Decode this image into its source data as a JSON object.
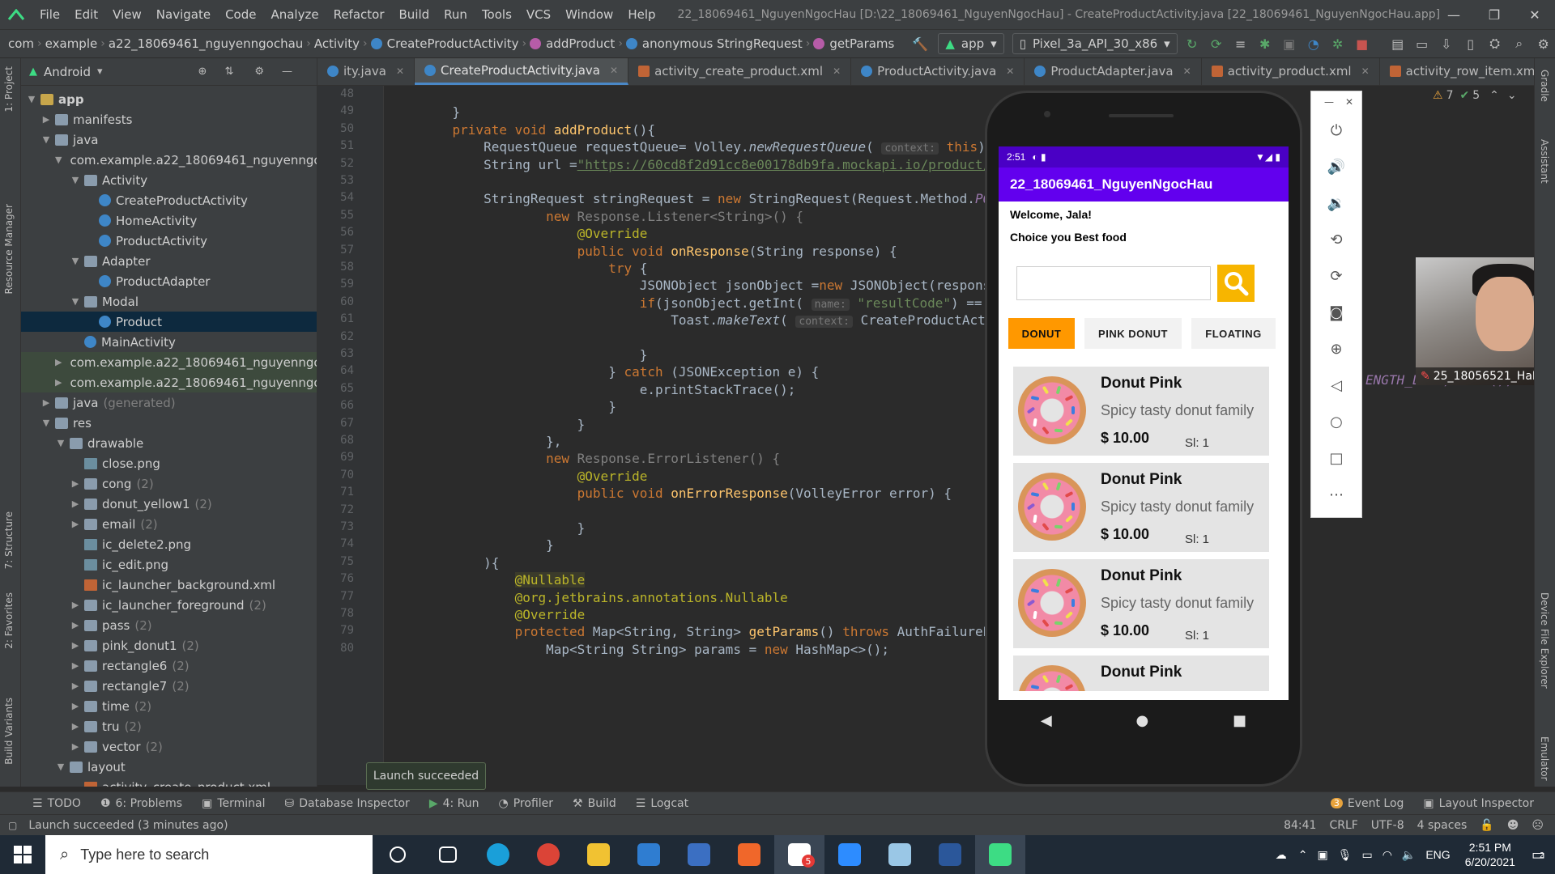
{
  "window": {
    "title": "22_18069461_NguyenNgocHau [D:\\22_18069461_NguyenNgocHau] - CreateProductActivity.java [22_18069461_NguyenNgocHau.app]",
    "menu": [
      "File",
      "Edit",
      "View",
      "Navigate",
      "Code",
      "Analyze",
      "Refactor",
      "Build",
      "Run",
      "Tools",
      "VCS",
      "Window",
      "Help"
    ]
  },
  "breadcrumb": [
    "com",
    "example",
    "a22_18069461_nguyenngochau",
    "Activity",
    "CreateProductActivity",
    "addProduct",
    "anonymous StringRequest",
    "getParams"
  ],
  "toolbar": {
    "run_config": "app",
    "device": "Pixel_3a_API_30_x86"
  },
  "project_panel": {
    "view": "Android",
    "tree": [
      {
        "label": "app",
        "depth": 0,
        "arrow": "▼",
        "icon": "folder-y",
        "bold": true
      },
      {
        "label": "manifests",
        "depth": 1,
        "arrow": "▶",
        "icon": "folder"
      },
      {
        "label": "java",
        "depth": 1,
        "arrow": "▼",
        "icon": "folder"
      },
      {
        "label": "com.example.a22_18069461_nguyenngo",
        "depth": 2,
        "arrow": "▼",
        "icon": "folder"
      },
      {
        "label": "Activity",
        "depth": 3,
        "arrow": "▼",
        "icon": "folder"
      },
      {
        "label": "CreateProductActivity",
        "depth": 4,
        "arrow": "",
        "icon": "cls"
      },
      {
        "label": "HomeActivity",
        "depth": 4,
        "arrow": "",
        "icon": "cls"
      },
      {
        "label": "ProductActivity",
        "depth": 4,
        "arrow": "",
        "icon": "cls"
      },
      {
        "label": "Adapter",
        "depth": 3,
        "arrow": "▼",
        "icon": "folder"
      },
      {
        "label": "ProductAdapter",
        "depth": 4,
        "arrow": "",
        "icon": "cls"
      },
      {
        "label": "Modal",
        "depth": 3,
        "arrow": "▼",
        "icon": "folder"
      },
      {
        "label": "Product",
        "depth": 4,
        "arrow": "",
        "icon": "cls",
        "selected": true
      },
      {
        "label": "MainActivity",
        "depth": 3,
        "arrow": "",
        "icon": "cls"
      },
      {
        "label": "com.example.a22_18069461_nguyenngo",
        "depth": 2,
        "arrow": "▶",
        "icon": "folder",
        "pkgsel": true
      },
      {
        "label": "com.example.a22_18069461_nguyenngo",
        "depth": 2,
        "arrow": "▶",
        "icon": "folder",
        "pkgsel": true
      },
      {
        "label": "java",
        "depth": 1,
        "arrow": "▶",
        "icon": "folder",
        "count": "(generated)"
      },
      {
        "label": "res",
        "depth": 1,
        "arrow": "▼",
        "icon": "folder"
      },
      {
        "label": "drawable",
        "depth": 2,
        "arrow": "▼",
        "icon": "folder"
      },
      {
        "label": "close.png",
        "depth": 3,
        "arrow": "",
        "icon": "file-img"
      },
      {
        "label": "cong",
        "depth": 3,
        "arrow": "▶",
        "icon": "folder",
        "count": "(2)"
      },
      {
        "label": "donut_yellow1",
        "depth": 3,
        "arrow": "▶",
        "icon": "folder",
        "count": "(2)"
      },
      {
        "label": "email",
        "depth": 3,
        "arrow": "▶",
        "icon": "folder",
        "count": "(2)"
      },
      {
        "label": "ic_delete2.png",
        "depth": 3,
        "arrow": "",
        "icon": "file-img"
      },
      {
        "label": "ic_edit.png",
        "depth": 3,
        "arrow": "",
        "icon": "file-img"
      },
      {
        "label": "ic_launcher_background.xml",
        "depth": 3,
        "arrow": "",
        "icon": "file-xml"
      },
      {
        "label": "ic_launcher_foreground",
        "depth": 3,
        "arrow": "▶",
        "icon": "folder",
        "count": "(2)"
      },
      {
        "label": "pass",
        "depth": 3,
        "arrow": "▶",
        "icon": "folder",
        "count": "(2)"
      },
      {
        "label": "pink_donut1",
        "depth": 3,
        "arrow": "▶",
        "icon": "folder",
        "count": "(2)"
      },
      {
        "label": "rectangle6",
        "depth": 3,
        "arrow": "▶",
        "icon": "folder",
        "count": "(2)"
      },
      {
        "label": "rectangle7",
        "depth": 3,
        "arrow": "▶",
        "icon": "folder",
        "count": "(2)"
      },
      {
        "label": "time",
        "depth": 3,
        "arrow": "▶",
        "icon": "folder",
        "count": "(2)"
      },
      {
        "label": "tru",
        "depth": 3,
        "arrow": "▶",
        "icon": "folder",
        "count": "(2)"
      },
      {
        "label": "vector",
        "depth": 3,
        "arrow": "▶",
        "icon": "folder",
        "count": "(2)"
      },
      {
        "label": "layout",
        "depth": 2,
        "arrow": "▼",
        "icon": "folder"
      },
      {
        "label": "activity_create_product.xml",
        "depth": 3,
        "arrow": "",
        "icon": "file-xml"
      }
    ]
  },
  "tabs": [
    {
      "label": "ity.java",
      "type": "java"
    },
    {
      "label": "CreateProductActivity.java",
      "type": "java",
      "active": true
    },
    {
      "label": "activity_create_product.xml",
      "type": "xml"
    },
    {
      "label": "ProductActivity.java",
      "type": "java"
    },
    {
      "label": "ProductAdapter.java",
      "type": "java"
    },
    {
      "label": "activity_product.xml",
      "type": "xml"
    },
    {
      "label": "activity_row_item.xml",
      "type": "xml"
    },
    {
      "label": "Product.java",
      "type": "java"
    }
  ],
  "editor": {
    "warnings": "7",
    "weak_warnings": "5",
    "lines": [
      {
        "n": "48",
        "html": ""
      },
      {
        "n": "49",
        "html": "    }"
      },
      {
        "n": "50",
        "html": "    <span class='kw'>private void </span><span class='fn'>addProduct</span>(){"
      },
      {
        "n": "51",
        "html": "        RequestQueue requestQueue= Volley.<span class='it'>newRequestQueue</span>( <span class='hint'>context:</span> <span class='kw'>this</span>);"
      },
      {
        "n": "52",
        "html": "        String url =<span class='str'>\"https://60cd8f2d91cc8e00178db9fa.mockapi.io/product/</span>"
      },
      {
        "n": "53",
        "html": ""
      },
      {
        "n": "54",
        "html": "        StringRequest stringRequest = <span class='kw'>new </span>StringRequest(Request.Method.<span class='it' style='color:#9876aa'>PO</span>"
      },
      {
        "n": "55",
        "html": "                <span class='kw'>new </span><span class='dim'>Response.Listener&lt;String&gt;() {</span>"
      },
      {
        "n": "56",
        "html": "                    <span class='ann'>@Override</span>"
      },
      {
        "n": "57",
        "html": "                    <span class='kw'>public void </span><span class='fn'>onResponse</span>(String response) {"
      },
      {
        "n": "58",
        "html": "                        <span class='kw'>try </span>{"
      },
      {
        "n": "59",
        "html": "                            JSONObject jsonObject =<span class='kw'>new </span>JSONObject(respons"
      },
      {
        "n": "60",
        "html": "                            <span class='kw'>if</span>(jsonObject.getInt( <span class='hint'>name:</span> <span class='strn'>\"resultCode\"</span>) == <span class='num'>0</span>"
      },
      {
        "n": "61",
        "html": "                                Toast.<span class='it'>makeText</span>( <span class='hint'>context:</span> CreateProductActivi"
      },
      {
        "n": "62",
        "html": ""
      },
      {
        "n": "63",
        "html": "                            }"
      },
      {
        "n": "64",
        "html": "                        } <span class='kw'>catch </span>(JSONException e) {"
      },
      {
        "n": "65",
        "html": "                            e.printStackTrace();"
      },
      {
        "n": "66",
        "html": "                        }"
      },
      {
        "n": "67",
        "html": "                    }"
      },
      {
        "n": "68",
        "html": "                },"
      },
      {
        "n": "69",
        "html": "                <span class='kw'>new </span><span class='dim'>Response.ErrorListener() {</span>"
      },
      {
        "n": "70",
        "html": "                    <span class='ann'>@Override</span>"
      },
      {
        "n": "71",
        "html": "                    <span class='kw'>public void </span><span class='fn'>onErrorResponse</span>(VolleyError error) {"
      },
      {
        "n": "72",
        "html": ""
      },
      {
        "n": "73",
        "html": "                    }"
      },
      {
        "n": "74",
        "html": "                }"
      },
      {
        "n": "75",
        "html": "        ){"
      },
      {
        "n": "76",
        "html": "            <span class='ann' style='background:#3b3b2b'>@Nullable</span>"
      },
      {
        "n": "77",
        "html": "            <span class='ann'>@org.jetbrains.annotations.Nullable</span>"
      },
      {
        "n": "78",
        "html": "            <span class='ann'>@Override</span>"
      },
      {
        "n": "79",
        "html": "            <span class='kw'>protected </span>Map&lt;String, String&gt; <span class='fn'>getParams</span>() <span class='kw'>throws </span>AuthFailureEr"
      },
      {
        "n": "80",
        "html": "                Map&lt;String String&gt; params = <span class='kw'>new </span>HashMap&lt;&gt;();"
      }
    ],
    "overflow_text": "ENGTH_LONG).show();"
  },
  "phone": {
    "time": "2:51",
    "app_title": "22_18069461_NguyenNgocHau",
    "welcome": "Welcome, Jala!",
    "subtitle": "Choice you Best food",
    "search_placeholder": "",
    "categories": [
      "DONUT",
      "PINK DONUT",
      "FLOATING"
    ],
    "items": [
      {
        "name": "Donut Pink",
        "desc": "Spicy tasty donut family",
        "price": "$ 10.00",
        "sl": "Sl: 1"
      },
      {
        "name": "Donut Pink",
        "desc": "Spicy tasty donut family",
        "price": "$ 10.00",
        "sl": "Sl: 1"
      },
      {
        "name": "Donut Pink",
        "desc": "Spicy tasty donut family",
        "price": "$ 10.00",
        "sl": "Sl: 1"
      },
      {
        "name": "Donut Pink",
        "desc": "",
        "price": "",
        "sl": ""
      }
    ]
  },
  "webcam": {
    "name": "25_18056521_HaHu"
  },
  "bottom_tools": [
    "TODO",
    "6: Problems",
    "Terminal",
    "Database Inspector",
    "4: Run",
    "Profiler",
    "Build",
    "Logcat"
  ],
  "bottom_tools_right": [
    "Event Log",
    "Layout Inspector"
  ],
  "event_log_count": "3",
  "launch_popup": "Launch succeeded",
  "status": {
    "message": "Launch succeeded (3 minutes ago)",
    "position": "84:41",
    "line_sep": "CRLF",
    "encoding": "UTF-8",
    "indent": "4 spaces"
  },
  "taskbar": {
    "search_placeholder": "Type here to search",
    "apps": [
      {
        "name": "task-view",
        "color": "#1f2a36"
      },
      {
        "name": "edge",
        "color": "#1a9fd9"
      },
      {
        "name": "chrome",
        "color": "#db4437"
      },
      {
        "name": "file-explorer",
        "color": "#f1c232"
      },
      {
        "name": "mail",
        "color": "#2f7dd1"
      },
      {
        "name": "app-blue",
        "color": "#3b6fc2"
      },
      {
        "name": "app-orange",
        "color": "#f0672a"
      },
      {
        "name": "zalo",
        "color": "#ffffff"
      },
      {
        "name": "zoom",
        "color": "#2d8cff"
      },
      {
        "name": "paint",
        "color": "#9ac7e6"
      },
      {
        "name": "word",
        "color": "#2b579a"
      },
      {
        "name": "android-studio",
        "color": "#3ddc84"
      }
    ],
    "badge": "5",
    "language": "ENG",
    "time": "2:51 PM",
    "date": "6/20/2021",
    "notifications": "2"
  },
  "colors": {
    "accent": "#6200ee",
    "status_purple": "#4a00c5",
    "search_button": "#f7b500",
    "donut_tab": "#ff9800"
  }
}
